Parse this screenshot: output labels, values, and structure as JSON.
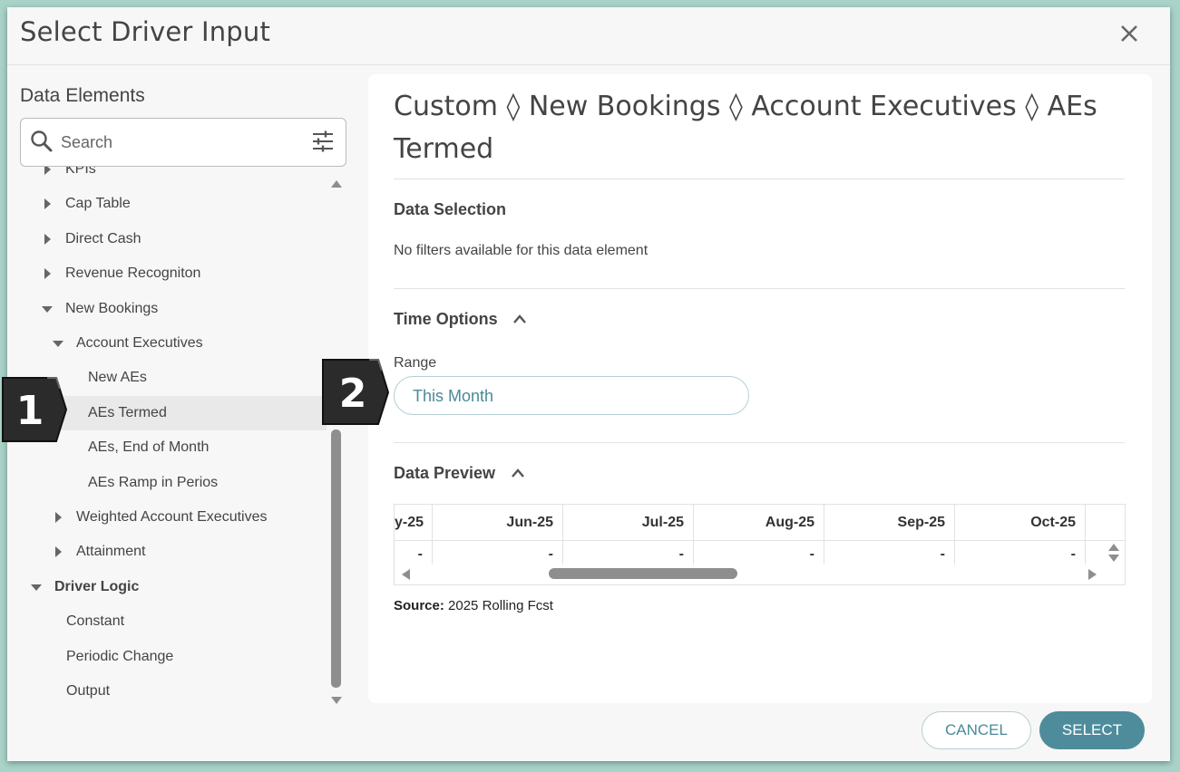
{
  "dialog": {
    "title": "Select Driver Input",
    "close_icon": "close-icon"
  },
  "left": {
    "section_label": "Data Elements",
    "search_placeholder": "Search",
    "tree": [
      {
        "label": "KPIs",
        "level": 0,
        "state": "collapsed"
      },
      {
        "label": "Cap Table",
        "level": 0,
        "state": "collapsed"
      },
      {
        "label": "Direct Cash",
        "level": 0,
        "state": "collapsed"
      },
      {
        "label": "Revenue Recogniton",
        "level": 0,
        "state": "collapsed"
      },
      {
        "label": "New Bookings",
        "level": 0,
        "state": "expanded"
      },
      {
        "label": "Account Executives",
        "level": 1,
        "state": "expanded"
      },
      {
        "label": "New AEs",
        "level": 2,
        "state": "leaf"
      },
      {
        "label": "AEs Termed",
        "level": 2,
        "state": "leaf",
        "selected": true
      },
      {
        "label": "AEs, End of Month",
        "level": 2,
        "state": "leaf"
      },
      {
        "label": "AEs Ramp in Perios",
        "level": 2,
        "state": "leaf"
      },
      {
        "label": "Weighted Account Executives",
        "level": 1,
        "state": "collapsed"
      },
      {
        "label": "Attainment",
        "level": 1,
        "state": "collapsed"
      },
      {
        "label": "Driver Logic",
        "level": -1,
        "state": "expanded",
        "bold": true
      },
      {
        "label": "Constant",
        "level": -1,
        "state": "leaf"
      },
      {
        "label": "Periodic Change",
        "level": -1,
        "state": "leaf"
      },
      {
        "label": "Output",
        "level": -1,
        "state": "leaf"
      }
    ]
  },
  "right": {
    "breadcrumb": "Custom ◊ New Bookings ◊ Account Executives ◊ AEs Termed",
    "data_selection": {
      "heading": "Data Selection",
      "text": "No filters available for this data element"
    },
    "time_options": {
      "heading": "Time Options",
      "range_label": "Range",
      "range_value": "This Month"
    },
    "data_preview": {
      "heading": "Data Preview",
      "columns": [
        "y-25",
        "Jun-25",
        "Jul-25",
        "Aug-25",
        "Sep-25",
        "Oct-25",
        ""
      ],
      "values": [
        "-",
        "-",
        "-",
        "-",
        "-",
        "-",
        ""
      ],
      "source_label": "Source:",
      "source_value": "2025 Rolling Fcst"
    }
  },
  "footer": {
    "cancel_label": "CANCEL",
    "select_label": "SELECT"
  },
  "callouts": {
    "one": "1",
    "two": "2"
  },
  "colors": {
    "accent": "#4e8c9c",
    "accent_text": "#4a8a98",
    "selected_row": "#e9e9e9",
    "callout_fill": "#2b2b2b"
  }
}
